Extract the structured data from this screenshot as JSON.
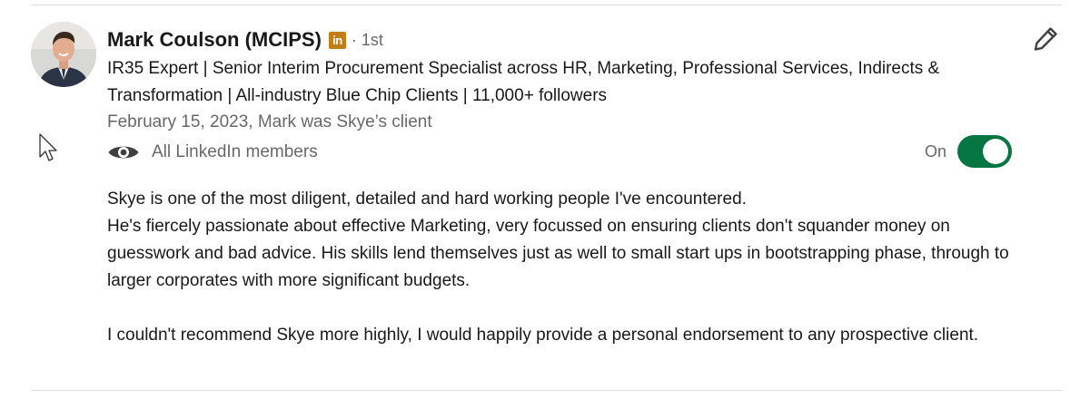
{
  "recommender": {
    "name": "Mark Coulson (MCIPS)",
    "badge_text": "in",
    "degree": "· 1st",
    "headline": "IR35 Expert | Senior Interim Procurement Specialist across HR, Marketing, Professional Services, Indirects & Transformation | All-industry Blue Chip Clients | 11,000+ followers",
    "meta": "February 15, 2023, Mark was Skye’s client"
  },
  "visibility": {
    "icon": "eye-icon",
    "label": "All LinkedIn members",
    "toggle_label": "On",
    "toggle_on": true
  },
  "recommendation": {
    "lines": [
      "Skye is one of the most diligent, detailed and hard working people I've encountered.",
      "He's fiercely passionate about effective Marketing, very focussed on ensuring clients don't squander money on guesswork and bad advice. His skills lend themselves just as well to small start ups in bootstrapping phase, through to larger corporates with more significant budgets.",
      "I couldn't recommend Skye more highly, I would happily provide a personal endorsement to any prospective client."
    ]
  },
  "icons": {
    "edit": "pencil-icon",
    "badge": "linkedin-premium-icon",
    "cursor": "mouse-pointer-icon"
  },
  "colors": {
    "toggle_on": "#057642",
    "badge": "#c37d16",
    "divider": "#e0dfdc"
  }
}
